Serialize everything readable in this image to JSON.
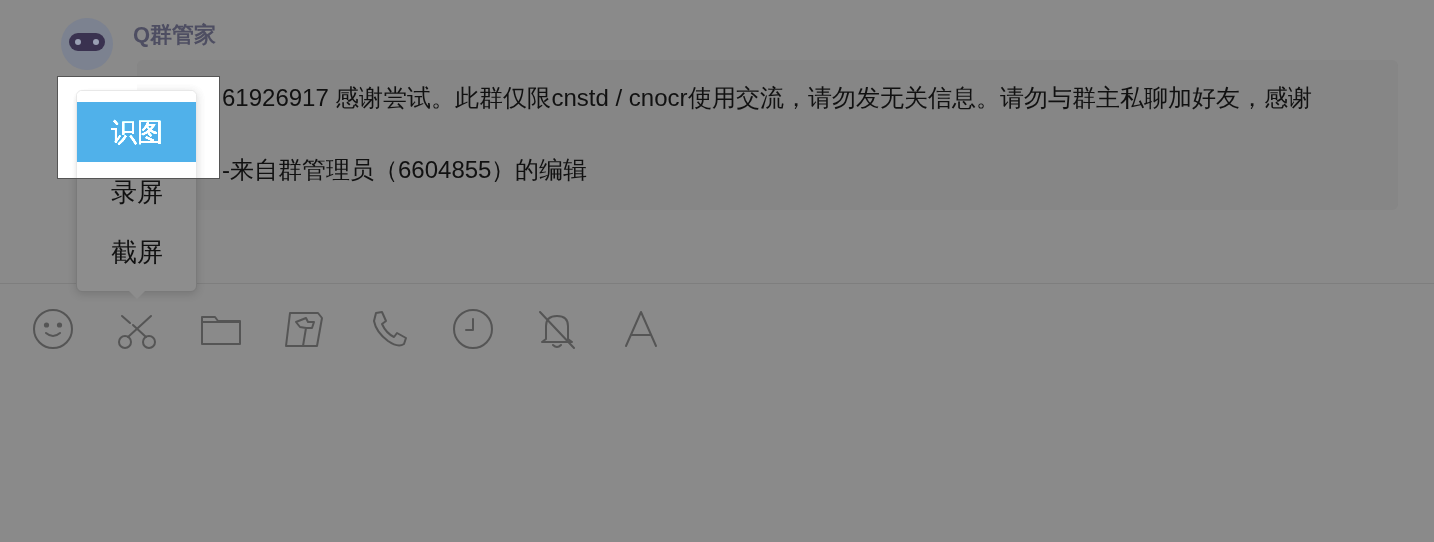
{
  "sender": {
    "name": "Q群管家"
  },
  "message": {
    "lines": [
      "61926917 感谢尝试。此群仅限cnstd / cnocr使用交流，请勿发无关信息。请勿与群主私聊加好友，感谢",
      "-来自群管理员（6604855）的编辑"
    ]
  },
  "capture_menu": {
    "items": [
      {
        "label": "识图",
        "selected": true
      },
      {
        "label": "录屏",
        "selected": false
      },
      {
        "label": "截屏",
        "selected": false
      }
    ]
  },
  "toolbar": {
    "tools": [
      {
        "kind": "emoji"
      },
      {
        "kind": "scissors"
      },
      {
        "kind": "folder"
      },
      {
        "kind": "map"
      },
      {
        "kind": "phone"
      },
      {
        "kind": "clock"
      },
      {
        "kind": "bell-off"
      },
      {
        "kind": "font"
      }
    ]
  }
}
